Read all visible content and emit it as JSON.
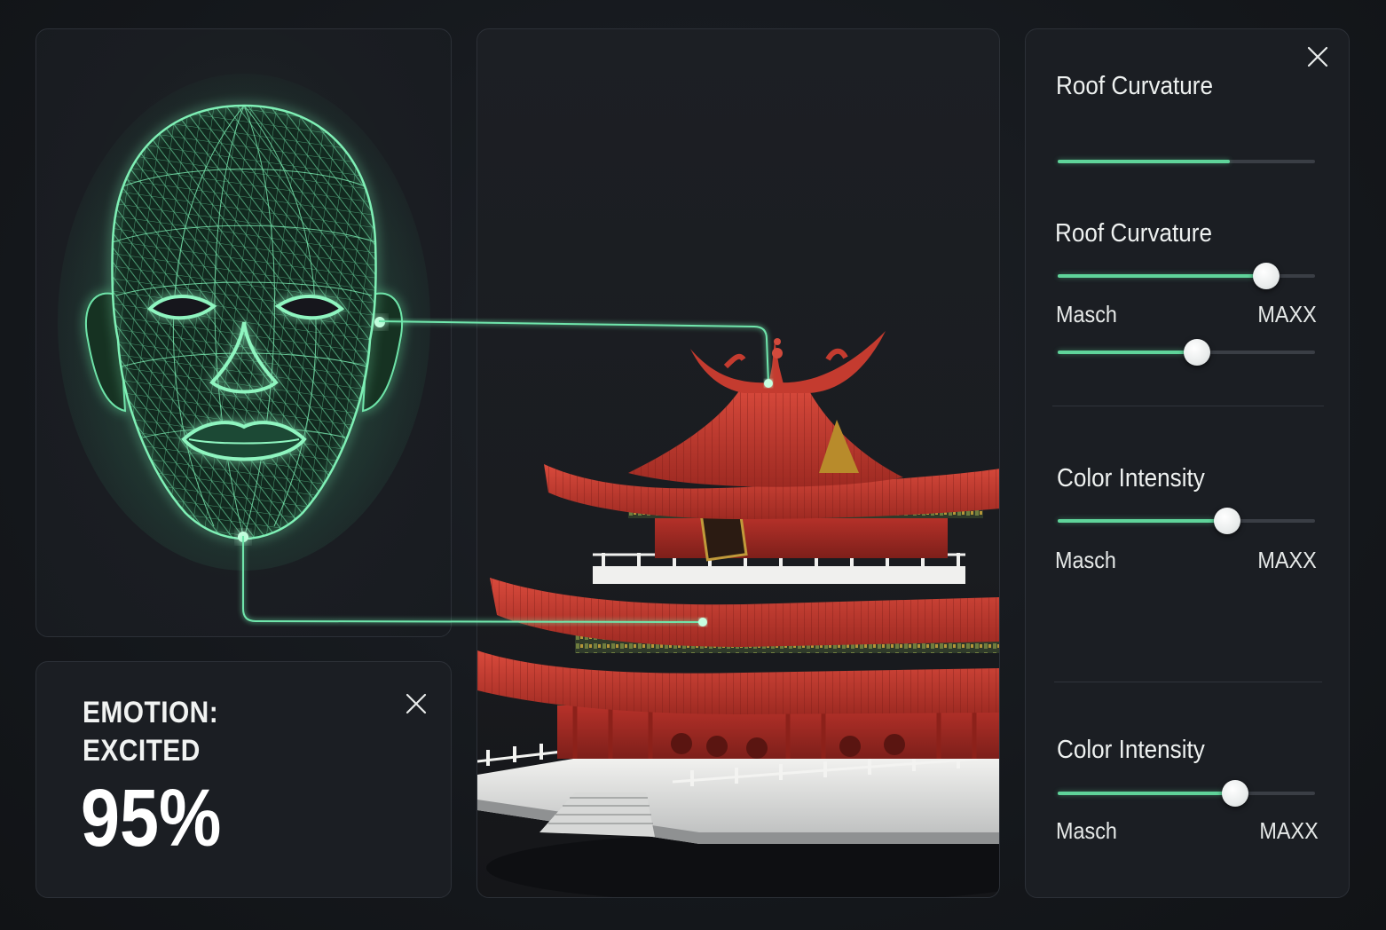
{
  "emotion": {
    "label_line1": "EMOTION:",
    "label_line2": "EXCITED",
    "confidence": "95%"
  },
  "controls": {
    "groups": [
      {
        "title": "Roof Curvature",
        "value": 0.67,
        "has_thumb": false
      },
      {
        "title": "Roof Curvature",
        "value": 0.81,
        "has_thumb": true,
        "min_label": "Masch",
        "max_label": "MAXX",
        "second_value": 0.54
      },
      {
        "title": "Color Intensity",
        "value": 0.66,
        "has_thumb": true,
        "min_label": "Masch",
        "max_label": "MAXX"
      },
      {
        "title": "Color Intensity",
        "value": 0.69,
        "has_thumb": true,
        "min_label": "Masch",
        "max_label": "MAXX"
      }
    ]
  },
  "colors": {
    "accent": "#5fd49a",
    "panel": "#1b1e23",
    "background": "#16191e",
    "temple_red": "#c9372c"
  },
  "icons": [
    "close-icon",
    "face-wireframe-icon",
    "temple-model-icon"
  ]
}
